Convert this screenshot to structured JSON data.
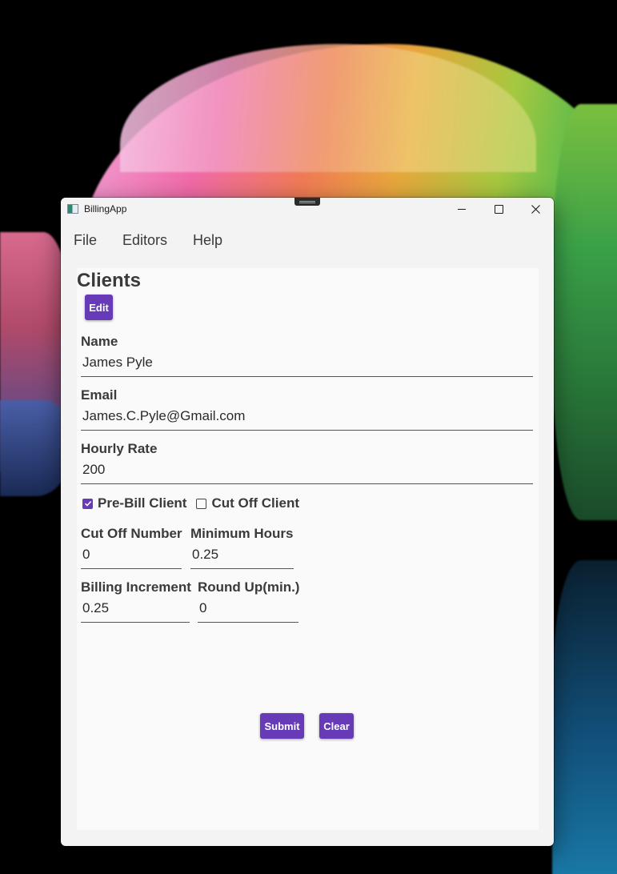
{
  "window": {
    "title": "BillingApp"
  },
  "menu": {
    "items": [
      "File",
      "Editors",
      "Help"
    ]
  },
  "clients": {
    "heading": "Clients",
    "edit_label": "Edit",
    "name_label": "Name",
    "name_value": "James Pyle",
    "email_label": "Email",
    "email_value": "James.C.Pyle@Gmail.com",
    "rate_label": "Hourly Rate",
    "rate_value": "200",
    "prebill_label": "Pre-Bill Client",
    "prebill_checked": true,
    "cutoff_label": "Cut Off Client",
    "cutoff_checked": false,
    "cutoff_number_label": "Cut Off Number",
    "cutoff_number_value": "0",
    "min_hours_label": "Minimum Hours",
    "min_hours_value": "0.25",
    "billing_increment_label": "Billing Increment",
    "billing_increment_value": "0.25",
    "round_up_label": "Round Up(min.)",
    "round_up_value": "0",
    "submit_label": "Submit",
    "clear_label": "Clear"
  },
  "colors": {
    "accent": "#673ab7"
  }
}
